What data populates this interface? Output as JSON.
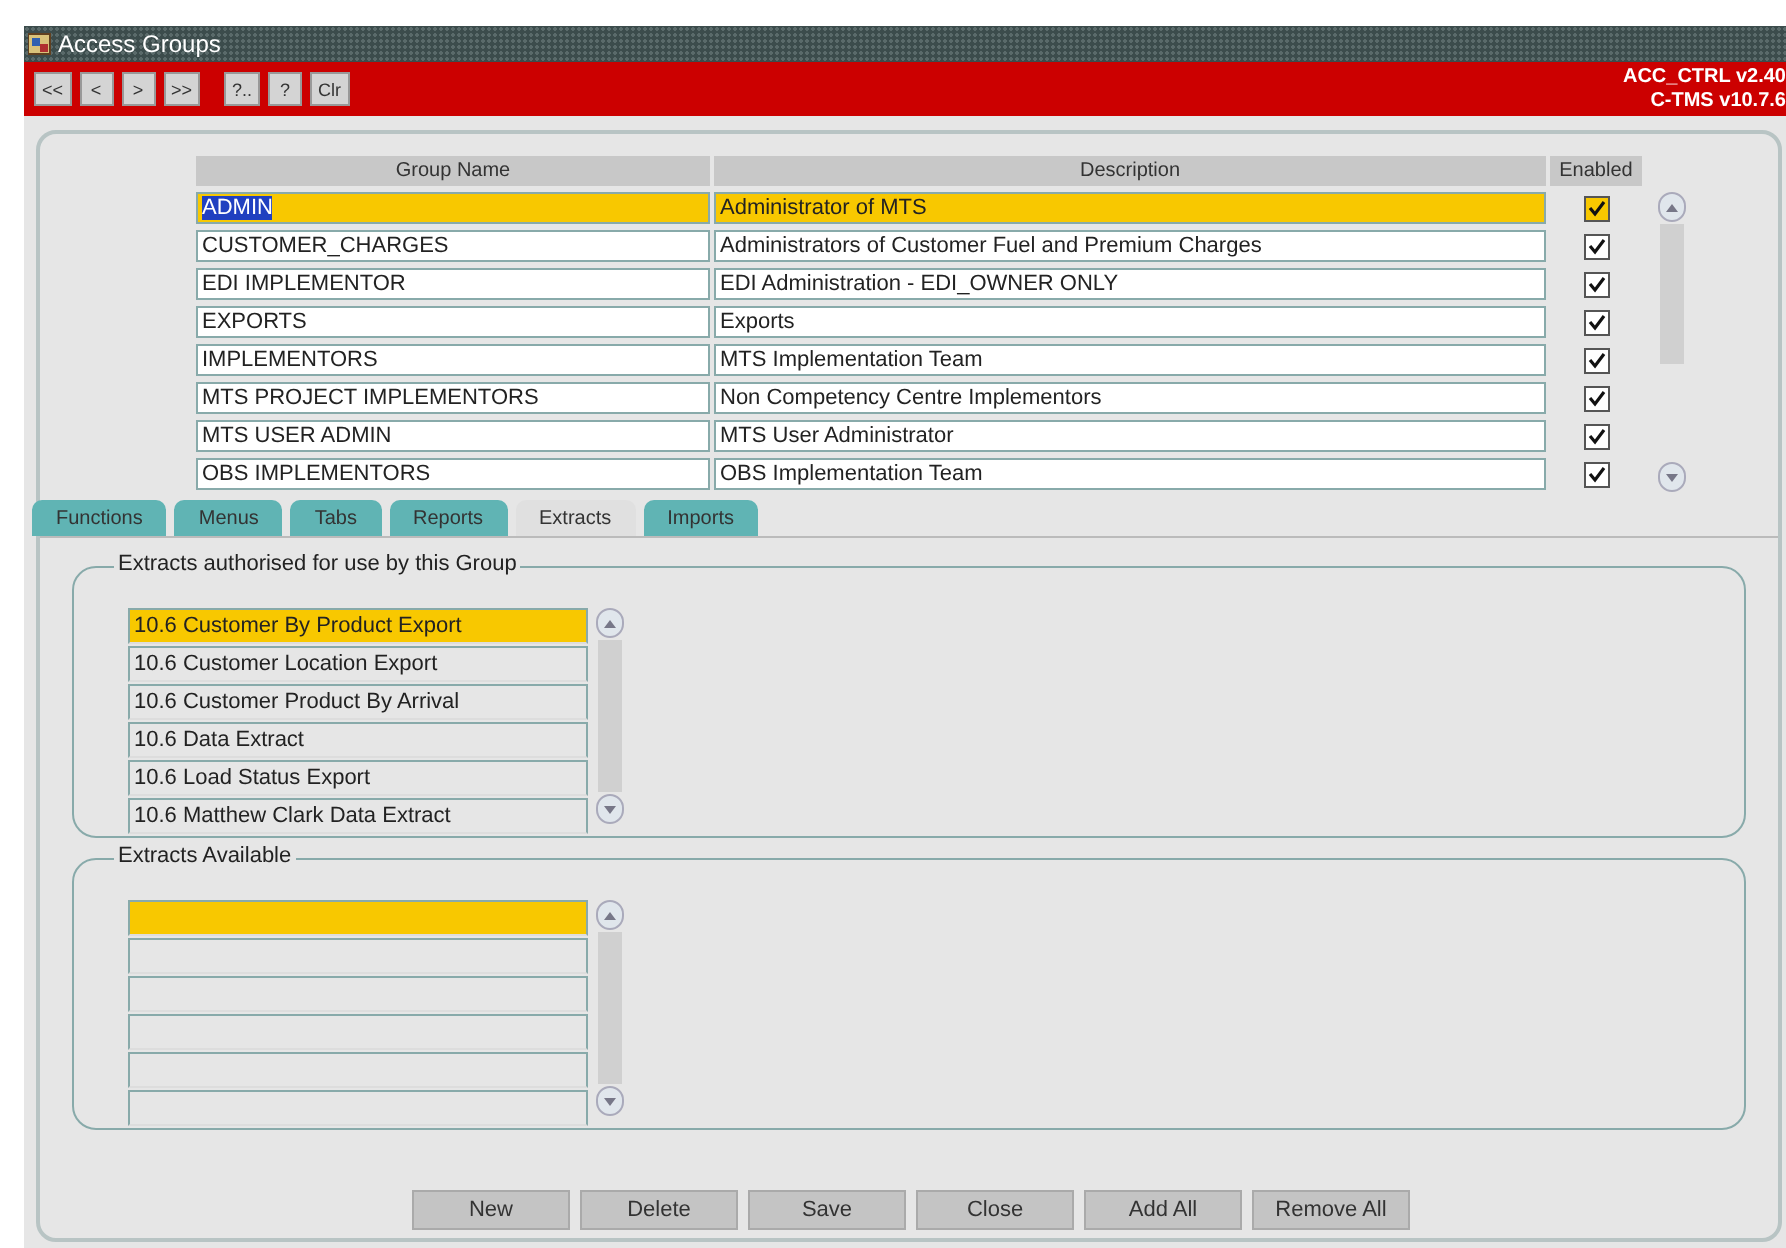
{
  "window": {
    "title": "Access Groups"
  },
  "toolbar": {
    "buttons": [
      "<<",
      "<",
      ">",
      ">>",
      "?..",
      "?",
      "Clr"
    ],
    "version_lines": [
      "ACC_CTRL v2.40",
      "C-TMS v10.7.6"
    ]
  },
  "table": {
    "columns": [
      "Group Name",
      "Description",
      "Enabled"
    ],
    "rows": [
      {
        "group_name": "ADMIN",
        "description": "Administrator of MTS",
        "enabled": true,
        "selected": true
      },
      {
        "group_name": "CUSTOMER_CHARGES",
        "description": "Administrators of Customer Fuel and Premium Charges",
        "enabled": true,
        "selected": false
      },
      {
        "group_name": "EDI IMPLEMENTOR",
        "description": "EDI Administration - EDI_OWNER ONLY",
        "enabled": true,
        "selected": false
      },
      {
        "group_name": "EXPORTS",
        "description": "Exports",
        "enabled": true,
        "selected": false
      },
      {
        "group_name": "IMPLEMENTORS",
        "description": "MTS Implementation Team",
        "enabled": true,
        "selected": false
      },
      {
        "group_name": "MTS PROJECT IMPLEMENTORS",
        "description": "Non Competency Centre Implementors",
        "enabled": true,
        "selected": false
      },
      {
        "group_name": "MTS USER ADMIN",
        "description": "MTS User Administrator",
        "enabled": true,
        "selected": false
      },
      {
        "group_name": "OBS IMPLEMENTORS",
        "description": "OBS Implementation Team",
        "enabled": true,
        "selected": false
      }
    ]
  },
  "tabs": [
    {
      "label": "Functions",
      "selected": false
    },
    {
      "label": "Menus",
      "selected": false
    },
    {
      "label": "Tabs",
      "selected": false
    },
    {
      "label": "Reports",
      "selected": false
    },
    {
      "label": "Extracts",
      "selected": true
    },
    {
      "label": "Imports",
      "selected": false
    }
  ],
  "authorised": {
    "title": "Extracts authorised for use by this Group",
    "items": [
      {
        "label": "10.6 Customer By Product Export",
        "selected": true
      },
      {
        "label": "10.6 Customer Location Export",
        "selected": false
      },
      {
        "label": "10.6 Customer Product By Arrival",
        "selected": false
      },
      {
        "label": "10.6 Data Extract",
        "selected": false
      },
      {
        "label": "10.6 Load Status Export",
        "selected": false
      },
      {
        "label": "10.6 Matthew Clark Data Extract",
        "selected": false
      }
    ]
  },
  "available": {
    "title": "Extracts Available",
    "first_row_selected": true
  },
  "buttons": [
    "New",
    "Delete",
    "Save",
    "Close",
    "Add All",
    "Remove All"
  ]
}
